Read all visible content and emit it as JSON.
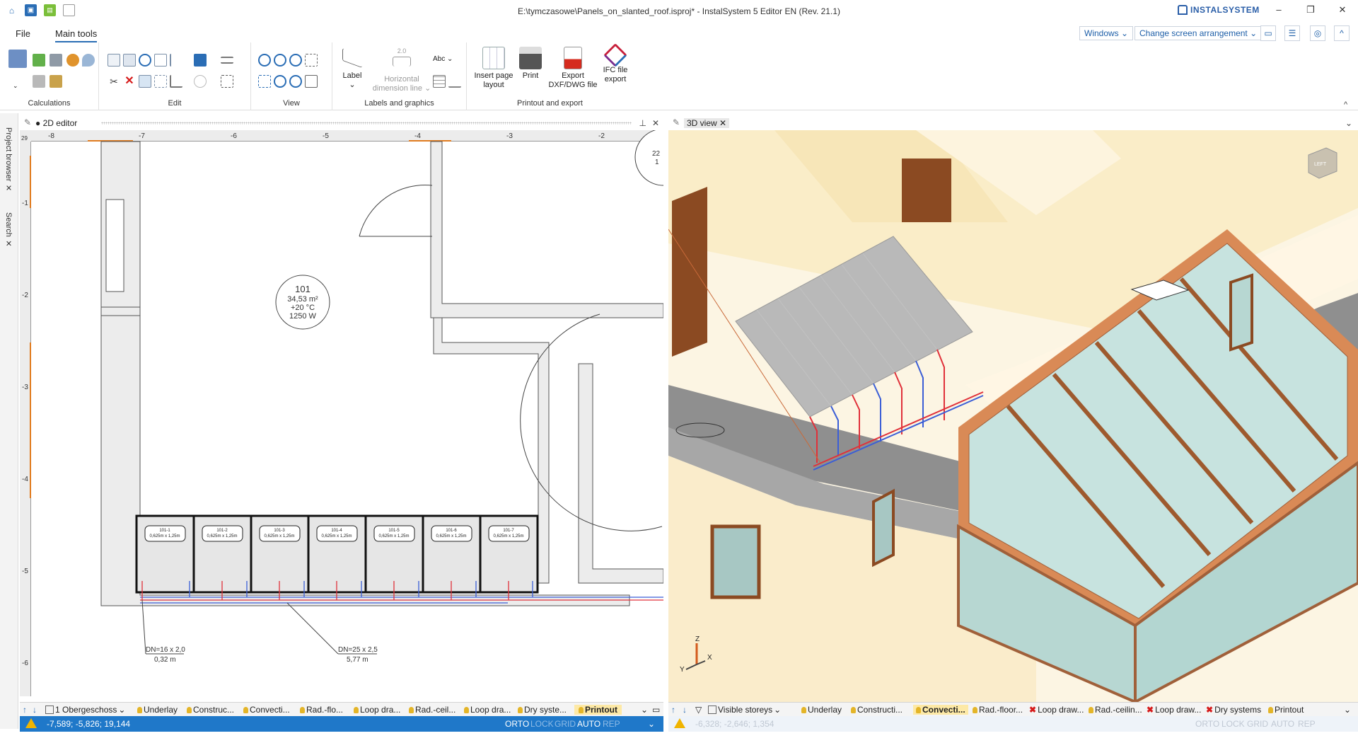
{
  "titlebar": {
    "title": "E:\\tymczasowe\\Panels_on_slanted_roof.isproj* - InstalSystem 5 Editor EN (Rev. 21.1)",
    "brand": "INSTALSYSTEM",
    "minimize": "–",
    "restore": "❐",
    "close": "✕"
  },
  "menu": {
    "file": "File",
    "main_tools": "Main tools"
  },
  "right_controls": {
    "windows": "Windows ⌄",
    "arrangement": "Change screen arrangement ⌄",
    "collapse": "^"
  },
  "ribbon": {
    "groups": {
      "calculations": "Calculations",
      "edit": "Edit",
      "view": "View",
      "labels": "Labels and graphics",
      "printout": "Printout and export"
    },
    "buttons": {
      "label": "Label",
      "label_arrow": "⌄",
      "hdim_1": "Horizontal",
      "hdim_2": "dimension line ⌄",
      "hdim_value": "2.0",
      "abc": "Abc ⌄",
      "insert_1": "Insert page",
      "insert_2": "layout",
      "print": "Print",
      "export_1": "Export",
      "export_2": "DXF/DWG file",
      "ifc_1": "IFC file",
      "ifc_2": "export"
    },
    "collapse_arrow": "^"
  },
  "side_tabs": {
    "project_browser": "Project browser",
    "search": "Search"
  },
  "editor2d": {
    "tab": "2D editor",
    "ruler_x": [
      "-8",
      "-7",
      "-6",
      "-5",
      "-4",
      "-3",
      "-2"
    ],
    "ruler_y": [
      "-1",
      "-2",
      "-3",
      "-4",
      "-5",
      "-6"
    ],
    "ruler_corner": "29",
    "room": {
      "number": "101",
      "area": "34,53 m²",
      "temp": "+20 °C",
      "power": "1250 W"
    },
    "panels": [
      {
        "id": "101-1",
        "size": "0,625m x 1,25m"
      },
      {
        "id": "101-2",
        "size": "0,625m x 1,25m"
      },
      {
        "id": "101-3",
        "size": "0,625m x 1,25m"
      },
      {
        "id": "101-4",
        "size": "0,625m x 1,25m"
      },
      {
        "id": "101-5",
        "size": "0,625m x 1,25m"
      },
      {
        "id": "101-6",
        "size": "0,625m x 1,25m"
      },
      {
        "id": "101-7",
        "size": "0,625m x 1,25m"
      }
    ],
    "pipe1": {
      "dn": "DN=16 x 2,0",
      "len": "0,32 m"
    },
    "pipe2": {
      "dn": "DN=25 x 2,5",
      "len": "5,77 m"
    },
    "cut_room_1": "22",
    "cut_room_2": "1"
  },
  "view3d": {
    "tab": "3D view",
    "axis_x": "X",
    "axis_y": "Y",
    "axis_z": "Z",
    "cube": "LEFT"
  },
  "bottom_left": {
    "storey": "1 Obergeschoss",
    "layers": [
      "Underlay",
      "Construc...",
      "Convecti...",
      "Rad.-flo...",
      "Loop dra...",
      "Rad.-ceil...",
      "Loop dra...",
      "Dry syste...",
      "Printout"
    ]
  },
  "bottom_right": {
    "visible": "Visible storeys",
    "layers": [
      "Underlay",
      "Constructi...",
      "Convecti...",
      "Rad.-floor...",
      "Loop draw...",
      "Rad.-ceilin...",
      "Loop draw...",
      "Dry systems",
      "Printout"
    ]
  },
  "status_left": {
    "coords": "-7,589; -5,826; 19,144",
    "orto": "ORTO",
    "lock": "LOCK",
    "grid": "GRID",
    "auto": "AUTO",
    "rep": "REP"
  },
  "status_right": {
    "coords": "-6,328; -2,646; 1,354",
    "orto": "ORTO",
    "lock": "LOCK",
    "grid": "GRID",
    "auto": "AUTO",
    "rep": "REP"
  }
}
